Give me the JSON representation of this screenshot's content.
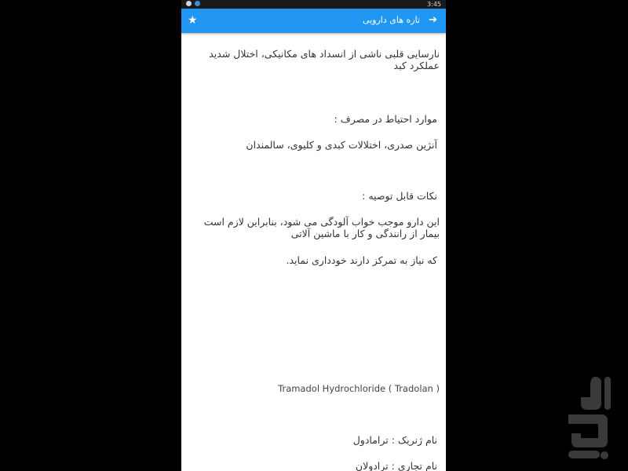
{
  "status_bar": {
    "time": "3:45",
    "icons": [
      "shield-icon",
      "circle-icon"
    ]
  },
  "app_bar": {
    "title": "تازه های دارویی",
    "star_icon": "star-icon",
    "back_icon": "arrow-right-icon",
    "color": "#2196f3"
  },
  "content": {
    "contraindications_text": "نارسایی قلبی ناشی از انسداد های مکانیکی، اختلال شدید عملکرد کبد",
    "precautions_heading": "موارد احتیاط در مصرف :",
    "precautions_text": "آنژین صدری، اختلالات کبدی و کلیوی، سالمندان",
    "tips_heading": "نکات قابل توصیه :",
    "tips_text_1": "این دارو موجب خواب آلودگی می شود، بنابراین لازم است بیمار از رانندگی و کار با ماشین آلاتی",
    "tips_text_2": "که نیاز به تمرکز دارند خودداری نماید.",
    "drug_title": "Tramadol Hydrochloride ( Tradolan )",
    "generic_name": "نام ژنریک : ترامادول",
    "brand_name": "نام تجاری : ترادولان"
  },
  "watermark": {
    "icon": "bazaar-logo-icon",
    "color": "#3a3a3a"
  }
}
